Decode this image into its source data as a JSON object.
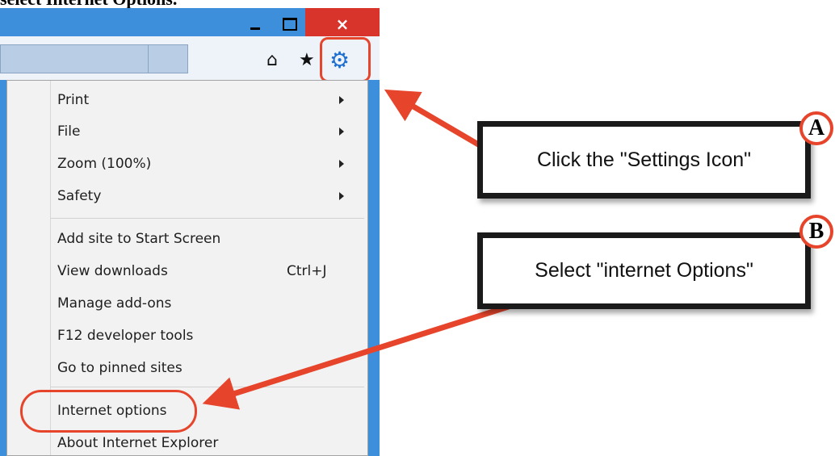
{
  "heading": "select Internet Options.",
  "window": {
    "minimize_icon": "minimize-icon",
    "maximize_icon": "maximize-icon",
    "close_glyph": "×"
  },
  "toolbar": {
    "home_glyph": "⌂",
    "star_glyph": "★",
    "gear_glyph": "⚙"
  },
  "menu": {
    "items": [
      {
        "label": "Print",
        "submenu": true
      },
      {
        "label": "File",
        "submenu": true
      },
      {
        "label": "Zoom (100%)",
        "submenu": true
      },
      {
        "label": "Safety",
        "submenu": true
      },
      {
        "label": "Add site to Start Screen"
      },
      {
        "label": "View downloads",
        "shortcut": "Ctrl+J"
      },
      {
        "label": "Manage add-ons"
      },
      {
        "label": "F12 developer tools"
      },
      {
        "label": "Go to pinned sites"
      },
      {
        "label": "Internet options"
      },
      {
        "label": "About Internet Explorer"
      }
    ]
  },
  "callouts": {
    "a": {
      "badge": "A",
      "text": "Click the \"Settings Icon\""
    },
    "b": {
      "badge": "B",
      "text": "Select \"internet Options\""
    }
  },
  "colors": {
    "accent_red": "#e6452c",
    "ie_blue": "#3d8fdc",
    "close_red": "#d8342b",
    "gear_blue": "#1f6fd1"
  }
}
